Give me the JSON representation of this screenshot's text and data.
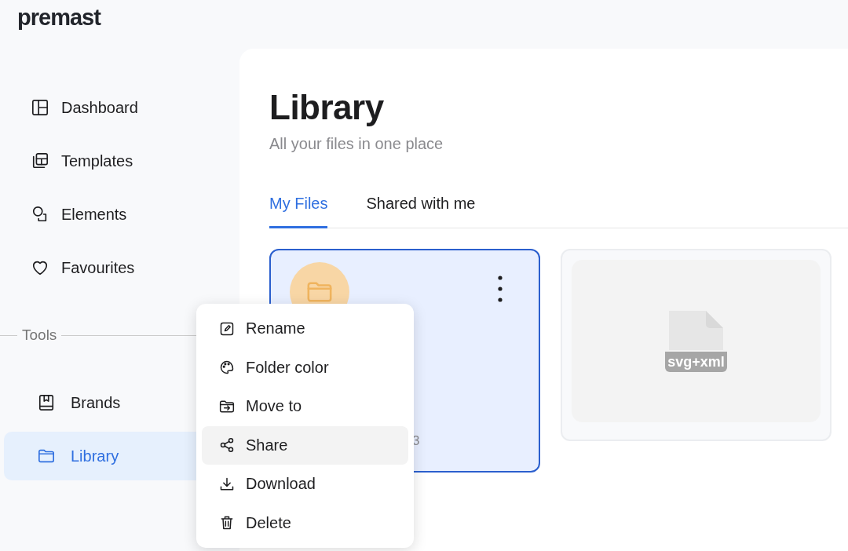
{
  "logo": "premast",
  "sidebar": {
    "items": [
      {
        "label": "Dashboard",
        "selected": false
      },
      {
        "label": "Templates",
        "selected": false
      },
      {
        "label": "Elements",
        "selected": false
      },
      {
        "label": "Favourites",
        "selected": false
      }
    ],
    "section_label": "Tools",
    "tool_items": [
      {
        "label": "Brands",
        "selected": false
      },
      {
        "label": "Library",
        "selected": true
      }
    ]
  },
  "header": {
    "title": "Library",
    "subtitle": "All your files in one place"
  },
  "tabs": [
    {
      "label": "My Files",
      "selected": true
    },
    {
      "label": "Shared with me",
      "selected": false
    }
  ],
  "files": [
    {
      "kind": "folder",
      "selected": true,
      "meta": "3"
    },
    {
      "kind": "file",
      "selected": false,
      "badge": "svg+xml"
    }
  ],
  "context_menu": {
    "items": [
      {
        "label": "Rename",
        "highlighted": false
      },
      {
        "label": "Folder color",
        "highlighted": false
      },
      {
        "label": "Move to",
        "highlighted": false
      },
      {
        "label": "Share",
        "highlighted": true
      },
      {
        "label": "Download",
        "highlighted": false
      },
      {
        "label": "Delete",
        "highlighted": false
      }
    ]
  }
}
